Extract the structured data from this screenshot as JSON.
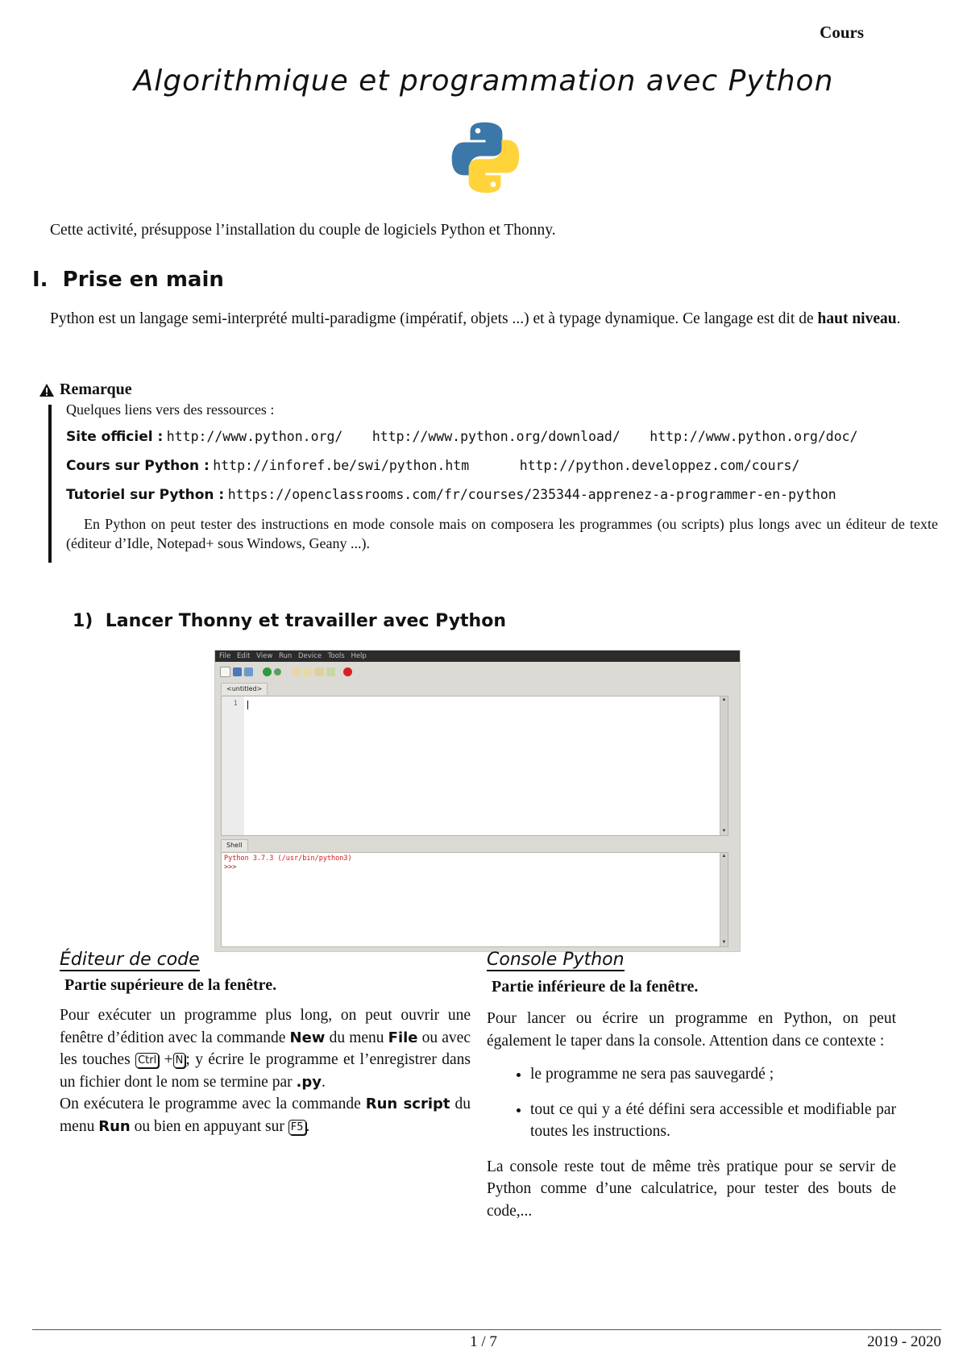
{
  "header": {
    "label": "Cours"
  },
  "title": "Algorithmique et programmation avec Python",
  "logo": {
    "name": "python-logo",
    "colors": {
      "blue": "#3b77a8",
      "yellow": "#ffd43b"
    }
  },
  "intro": "Cette activité, présuppose l’installation du couple de logiciels Python et Thonny.",
  "section1": {
    "number": "I.",
    "title": "Prise en main",
    "text_before": "Python est un langage semi-interprété multi-paradigme (impératif, objets ...) et à typage dynamique. Ce langage est dit de ",
    "text_bold": "haut niveau",
    "text_after": "."
  },
  "remark": {
    "title": "Remarque",
    "icon": "warning-icon",
    "intro": "Quelques liens vers des ressources :",
    "resources": [
      {
        "label": "Site officiel :",
        "links": [
          "http://www.python.org/",
          "http://www.python.org/download/",
          "http://www.python.org/doc/"
        ]
      },
      {
        "label": "Cours sur Python :",
        "links": [
          "http://inforef.be/swi/python.htm",
          "http://python.developpez.com/cours/"
        ]
      },
      {
        "label": "Tutoriel sur Python :",
        "links": [
          "https://openclassrooms.com/fr/courses/235344-apprenez-a-programmer-en-python"
        ]
      }
    ],
    "note": "En Python on peut tester des instructions en mode console mais on composera les programmes (ou scripts) plus longs avec un éditeur de texte (éditeur d’Idle, Notepad+ sous Windows, Geany ...)."
  },
  "subsection1": {
    "number": "1)",
    "title": "Lancer Thonny et travailler avec Python"
  },
  "thonny": {
    "menu": [
      "File",
      "Edit",
      "View",
      "Run",
      "Device",
      "Tools",
      "Help"
    ],
    "editor_tab": "<untitled>",
    "line_number": "1",
    "shell_tab": "Shell",
    "shell_lines": [
      "Python 3.7.3 (/usr/bin/python3)",
      ">>>"
    ]
  },
  "left_col": {
    "heading": "Éditeur de code",
    "subheading": "Partie supérieure de la fenêtre.",
    "p1": [
      "Pour exécuter un programme plus long, on peut ouvrir une fenêtre d’édition avec la commande ",
      "New",
      " du menu ",
      "File",
      " ou avec les touches ",
      "Ctrl",
      " +",
      "N",
      "; y écrire le programme et l’enregistrer dans un fichier dont le nom se termine par ",
      ".py",
      "."
    ],
    "p2": [
      "On exécutera le programme avec la commande ",
      "Run script",
      " du menu ",
      "Run",
      " ou bien en appuyant sur ",
      "F5",
      "."
    ]
  },
  "right_col": {
    "heading": "Console Python",
    "subheading": "Partie inférieure de la fenêtre.",
    "p1": "Pour lancer ou écrire un programme en Python, on peut également le taper dans la console. Attention dans ce contexte :",
    "bullets": [
      "le programme ne sera pas sauvegardé ;",
      "tout ce qui y a été défini sera accessible et modifiable par toutes les instructions."
    ],
    "p2": "La console reste tout de même très pratique pour se servir de Python comme d’une calculatrice, pour tester des bouts de code,..."
  },
  "footer": {
    "page": "1 / 7",
    "year": "2019 - 2020"
  }
}
